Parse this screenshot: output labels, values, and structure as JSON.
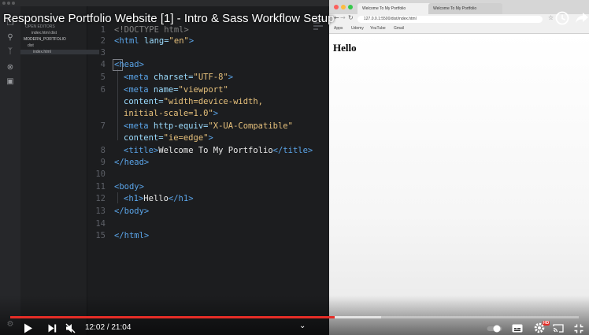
{
  "video": {
    "title": "Responsive Portfolio Website [1] - Intro & Sass Workflow Setup",
    "current_time": "12:02",
    "duration": "21:04",
    "time_display": "12:02 / 21:04",
    "progress_fraction": 0.571,
    "buffered_fraction": 0.652,
    "hd_badge": "HD",
    "accent_color": "#e52d27"
  },
  "vscode": {
    "sidebar": {
      "open_editors": "OPEN EDITORS",
      "open_file": "index.html dist",
      "project": "MODERN_PORTFOLIO",
      "folder": "dist",
      "file": "index.html"
    },
    "line_numbers": [
      "1",
      "2",
      "3",
      "4",
      "5",
      "6",
      "7",
      "8",
      "9",
      "10",
      "11",
      "12",
      "13",
      "14",
      "15"
    ],
    "code": {
      "l1": "<!DOCTYPE html>",
      "l2_tag": "<html",
      "l2_attr": " lang=",
      "l2_val": "\"en\"",
      "l2_end": ">",
      "l4": "<head>",
      "l5_tag": "<meta",
      "l5_attr": " charset=",
      "l5_val": "\"UTF-8\"",
      "l5_end": ">",
      "l6_tag": "<meta",
      "l6_attr": " name=",
      "l6_val": "\"viewport\"",
      "l6b_attr": "content=",
      "l6b_val": "\"width=device-width,",
      "l6c_val": "initial-scale=1.0\"",
      "l6c_end": ">",
      "l7_tag": "<meta",
      "l7_attr": " http-equiv=",
      "l7_val": "\"X-UA-Compatible\"",
      "l7b_attr": "content=",
      "l7b_val": "\"ie=edge\"",
      "l7b_end": ">",
      "l8_tag": "<title>",
      "l8_text": "Welcome To My Portfolio",
      "l8_end": "</title>",
      "l9": "</head>",
      "l11": "<body>",
      "l12_tag": "<h1>",
      "l12_text": "Hello",
      "l12_end": "</h1>",
      "l13": "</body>",
      "l15": "</html>"
    }
  },
  "browser": {
    "tab_active": "Welcome To My Portfolio",
    "tab_second": "Welcome To My Portfolio",
    "url": "127.0.0.1:5500/dist/index.html",
    "bookmarks": [
      "Apps",
      "Udemy",
      "YouTube",
      "Gmail"
    ],
    "page_heading": "Hello"
  }
}
